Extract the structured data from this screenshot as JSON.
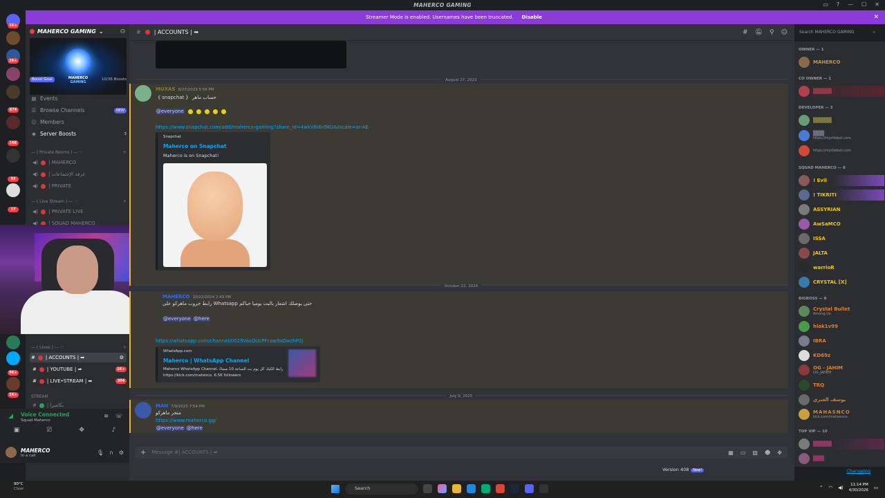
{
  "window": {
    "title": "MAHERCO GAMING"
  },
  "banner": {
    "text": "Streamer Mode is enabled. Usernames have been truncated.",
    "disable": "Disable"
  },
  "server": {
    "name": "MAHERCO GAMING",
    "boost_goal": "Boost Goal",
    "boosts": "10/36 Boosts",
    "banner_line1": "MAHERCO",
    "banner_line2": "GAMING"
  },
  "server_badges": [
    "1K+",
    "2K+",
    "674",
    "166",
    "33",
    "17",
    "9K+",
    "1K+"
  ],
  "nav": [
    {
      "label": "Events"
    },
    {
      "label": "Browse Channels",
      "pill": "NEW"
    },
    {
      "label": "Members"
    },
    {
      "label": "Server Boosts",
      "count": "3"
    }
  ],
  "categories": {
    "private": "— ( Private Rooms ) — ·:·",
    "live": "— ( Live Stream ) — ·:·",
    "lives": "— ( Lives ) — ·:·",
    "stream": "STREAM"
  },
  "channels": {
    "private": [
      "| MAHERCO",
      "| غرفة الإجتماعات",
      "| PRIVATE"
    ],
    "live": [
      "| PRIVATE LIVE",
      "| SQUAD MAHERCO"
    ],
    "text": [
      {
        "name": "| ACCOUNTS | ➡"
      },
      {
        "name": "| YOUTUBE | ➡",
        "badge": "1K+"
      },
      {
        "name": "| LIVE•STREAM | ➡",
        "badge": "304"
      }
    ],
    "partial": "| بكاميرا"
  },
  "voice": {
    "status": "Voice Connected",
    "sub": "Squad Maherco"
  },
  "user": {
    "name": "MAHERCO",
    "status": "In a call"
  },
  "header": {
    "channel": "| ACCOUNTS | ➡"
  },
  "search": {
    "placeholder": "Search MAHERCO GAMING"
  },
  "messages": {
    "date1": "August 27, 2023",
    "m1": {
      "author": "MUXAS",
      "time": "8/27/2023 5:56 PM",
      "line1": "《 snapchat 》 حساب ماهر",
      "mention": "@everyone",
      "link": "https://www.snapchat.com/add/maherco-gaming?share_id=4wkV8i6x9KU&locale=ar-AE",
      "embed_provider": "Snapchat",
      "embed_title": "Maherco on Snapchat",
      "embed_desc": "Maherco is on Snapchat!"
    },
    "date2": "October 22, 2024",
    "m2": {
      "author": "MAHERCO",
      "time": "10/22/2024 2:43 PM",
      "line1": "رابط جروب ماهركو على Whatsapp حتى يوصلك اشعار بالبث يوميا حياكم",
      "mention1": "@everyone",
      "mention2": "@here",
      "link": "https://whatsapp.com/channel/0029VasOUcPFcow9sOwzhP2j",
      "embed_provider": "WhatsApp.com",
      "embed_title": "Maherco | WhatsApp Channel",
      "embed_desc1": "Maherco WhatsApp Channel. رابط الكيك كل يوم بث الساعة 10 مساءً",
      "embed_desc2": "https://kick.com/maherco. 6.5K followers"
    },
    "date3": "July 9, 2025",
    "m3": {
      "author": "MAH",
      "time": "7/9/2025 7:54 PM",
      "line1": "متجر ماهركو",
      "link": "https://www.maherco.gg/",
      "mention1": "@everyone",
      "mention2": "@here"
    }
  },
  "composer": {
    "placeholder": "Message #| ACCOUNTS | ➡"
  },
  "members": {
    "owner": "OWNER — 1",
    "owner_list": [
      {
        "name": "MAHERCO",
        "color": "#c29a4a"
      }
    ],
    "co_owner": "CO OWNER — 1",
    "co_owner_list": [
      {
        "name": "▒▒▒▒▒",
        "color": "#e0455c"
      }
    ],
    "developer": "DEVELOPER — 3",
    "developer_list": [
      {
        "name": "▒▒▒▒▒",
        "color": "#c8b850"
      },
      {
        "name": "▒▒▒",
        "color": "#aab",
        "sub": "https://myrtlebot.com"
      },
      {
        "name": "",
        "color": "#aab",
        "sub": "https://myrtlebot.com"
      }
    ],
    "squad": "SQUAD MAHERCO — 8",
    "squad_list": [
      {
        "name": "! Evil",
        "color": "#f1c40f"
      },
      {
        "name": "! TIKRITI",
        "color": "#f1c40f"
      },
      {
        "name": "ASSYRIAN",
        "color": "#f1c40f"
      },
      {
        "name": "AwSaMCO",
        "color": "#f1c40f"
      },
      {
        "name": "ISSA",
        "color": "#f1c40f"
      },
      {
        "name": "JALTA",
        "color": "#f1c40f"
      },
      {
        "name": "warrioR",
        "color": "#f1c40f"
      },
      {
        "name": "CRYSTAL [X]",
        "color": "#f1c40f"
      }
    ],
    "bigboss": "BIGBOSS — 8",
    "bigboss_list": [
      {
        "name": "Crystal Bullet",
        "color": "#e67e22",
        "sub": "Among Us"
      },
      {
        "name": "hlak1v99",
        "color": "#e67e22"
      },
      {
        "name": "IBRA",
        "color": "#e67e22"
      },
      {
        "name": "KD69z",
        "color": "#e67e22"
      },
      {
        "name": "OG - JAHIM",
        "color": "#e67e22",
        "sub": "OG_JAHEM"
      },
      {
        "name": "TRQ",
        "color": "#e67e22"
      },
      {
        "name": "يوسف العنزي",
        "color": "#e67e22"
      },
      {
        "name": "MAHASNCO",
        "color": "#e67e22",
        "sub": "kick.com/mahasnco"
      }
    ],
    "topvip": "TOP VIP — 10",
    "topvip_list": [
      {
        "name": "▒▒▒▒▒",
        "color": "#e84393"
      },
      {
        "name": "▒▒▒",
        "color": "#e84393"
      }
    ]
  },
  "footer": {
    "version": "Version 408",
    "new": "New!",
    "changelog": "Changelog"
  },
  "taskbar": {
    "weather_temp": "90°C",
    "weather_desc": "Clear",
    "search": "Search",
    "time": "11:14 PM",
    "date": "4/30/2026"
  }
}
